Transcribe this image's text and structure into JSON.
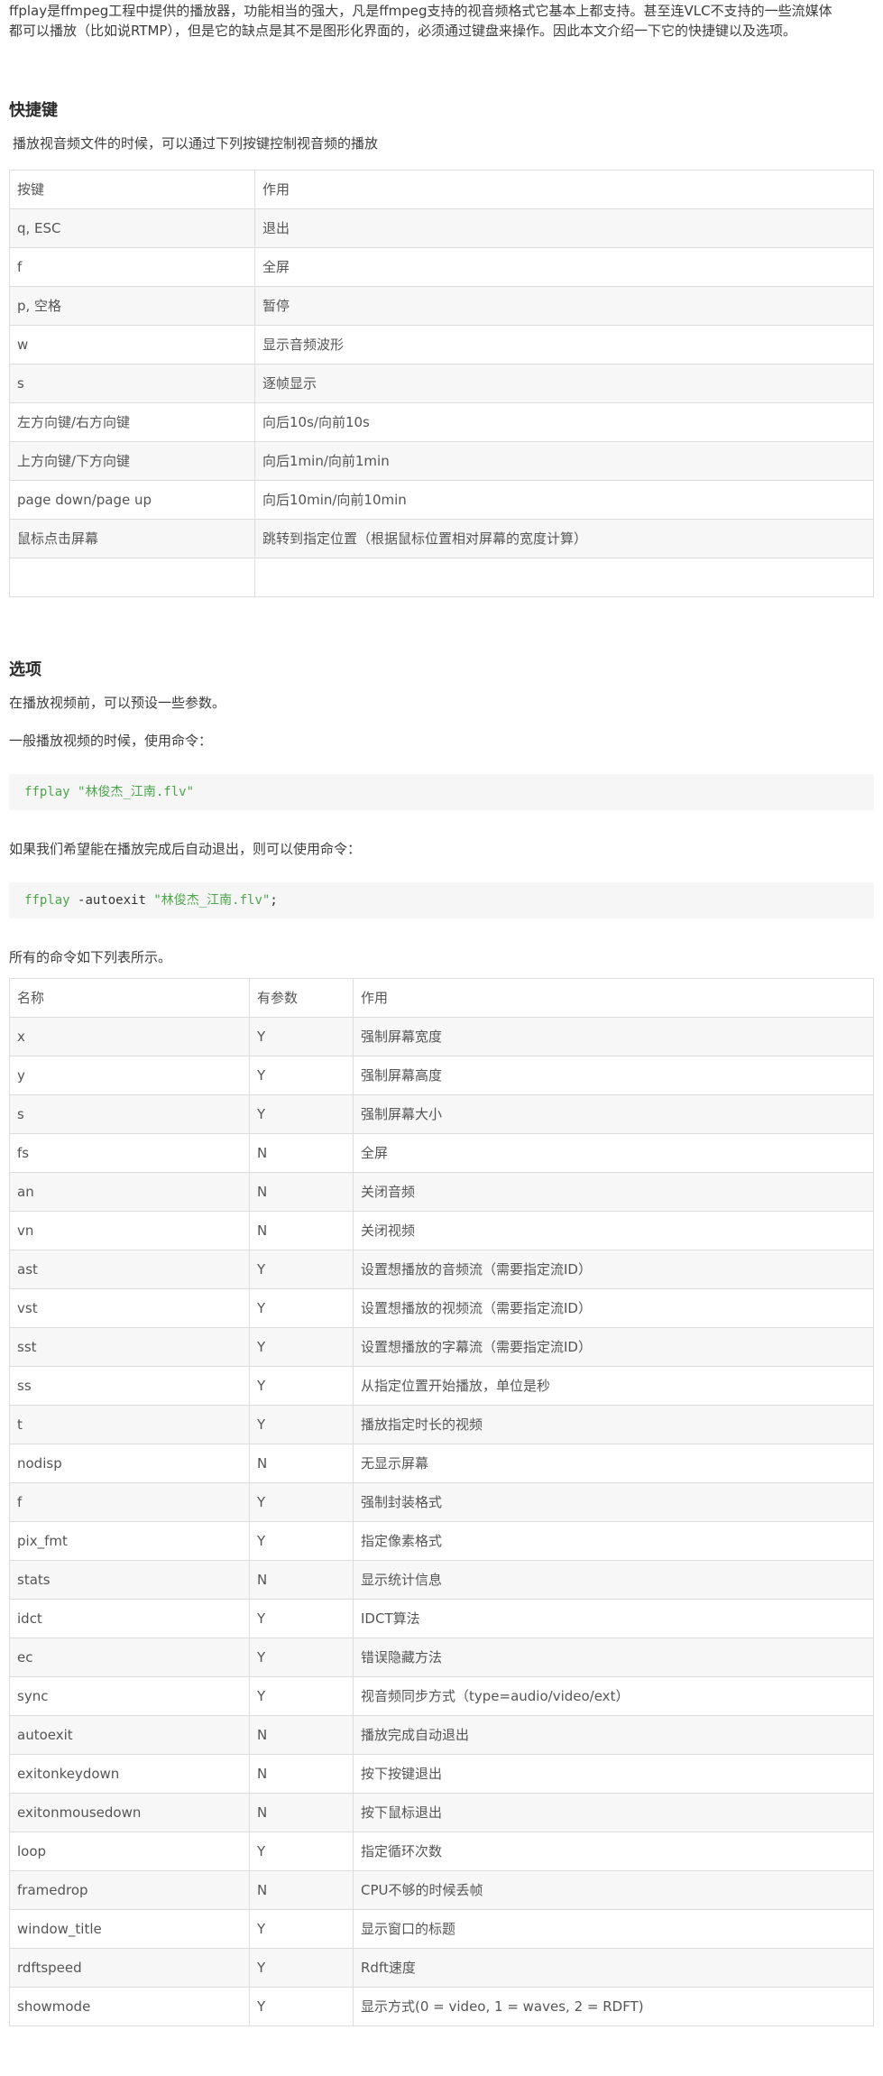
{
  "intro": {
    "line1": "ffplay是ffmpeg工程中提供的播放器，功能相当的强大，凡是ffmpeg支持的视音频格式它基本上都支持。甚至连VLC不支持的一些流媒体",
    "line2": "都可以播放（比如说RTMP），但是它的缺点是其不是图形化界面的，必须通过键盘来操作。因此本文介绍一下它的快捷键以及选项。"
  },
  "shortcuts": {
    "heading": "快捷键",
    "desc": "播放视音频文件的时候，可以通过下列按键控制视音频的播放",
    "header": [
      "按键",
      "作用"
    ],
    "rows": [
      [
        "q, ESC",
        "退出"
      ],
      [
        "f",
        "全屏"
      ],
      [
        "p, 空格",
        "暂停"
      ],
      [
        "w",
        "显示音频波形"
      ],
      [
        "s",
        "逐帧显示"
      ],
      [
        "左方向键/右方向键",
        "向后10s/向前10s"
      ],
      [
        "上方向键/下方向键",
        "向后1min/向前1min"
      ],
      [
        "page down/page up",
        "向后10min/向前10min"
      ],
      [
        "鼠标点击屏幕",
        "跳转到指定位置（根据鼠标位置相对屏幕的宽度计算）"
      ],
      [
        "",
        ""
      ]
    ]
  },
  "options": {
    "heading": "选项",
    "para1": "在播放视频前，可以预设一些参数。",
    "para2": "一般播放视频的时候，使用命令：",
    "code1": {
      "cmd": "ffplay",
      "arg": "\"林俊杰_江南.flv\""
    },
    "para3": "如果我们希望能在播放完成后自动退出，则可以使用命令：",
    "code2": {
      "cmd": "ffplay",
      "flag": "-autoexit",
      "arg": "\"林俊杰_江南.flv\"",
      "end": ";"
    },
    "para4": "所有的命令如下列表所示。",
    "header": [
      "名称",
      "有参数",
      "作用"
    ],
    "rows": [
      [
        "x",
        "Y",
        "强制屏幕宽度"
      ],
      [
        "y",
        "Y",
        "强制屏幕高度"
      ],
      [
        "s",
        "Y",
        "强制屏幕大小"
      ],
      [
        "fs",
        "N",
        "全屏"
      ],
      [
        "an",
        "N",
        "关闭音频"
      ],
      [
        "vn",
        "N",
        "关闭视频"
      ],
      [
        "ast",
        "Y",
        "设置想播放的音频流（需要指定流ID）"
      ],
      [
        "vst",
        "Y",
        "设置想播放的视频流（需要指定流ID）"
      ],
      [
        "sst",
        "Y",
        "设置想播放的字幕流（需要指定流ID）"
      ],
      [
        "ss",
        "Y",
        "从指定位置开始播放，单位是秒"
      ],
      [
        "t",
        "Y",
        "播放指定时长的视频"
      ],
      [
        "nodisp",
        "N",
        "无显示屏幕"
      ],
      [
        "f",
        "Y",
        "强制封装格式"
      ],
      [
        "pix_fmt",
        "Y",
        "指定像素格式"
      ],
      [
        "stats",
        "N",
        "显示统计信息"
      ],
      [
        "idct",
        "Y",
        "IDCT算法"
      ],
      [
        "ec",
        "Y",
        "错误隐藏方法"
      ],
      [
        "sync",
        "Y",
        "视音频同步方式（type=audio/video/ext）"
      ],
      [
        "autoexit",
        "N",
        "播放完成自动退出"
      ],
      [
        "exitonkeydown",
        "N",
        "按下按键退出"
      ],
      [
        "exitonmousedown",
        "N",
        "按下鼠标退出"
      ],
      [
        "loop",
        "Y",
        "指定循环次数"
      ],
      [
        "framedrop",
        "N",
        "CPU不够的时候丢帧"
      ],
      [
        "window_title",
        "Y",
        "显示窗口的标题"
      ],
      [
        "rdftspeed",
        "Y",
        "Rdft速度"
      ],
      [
        "showmode",
        "Y",
        "显示方式(0 = video, 1 = waves, 2 = RDFT)"
      ]
    ]
  }
}
